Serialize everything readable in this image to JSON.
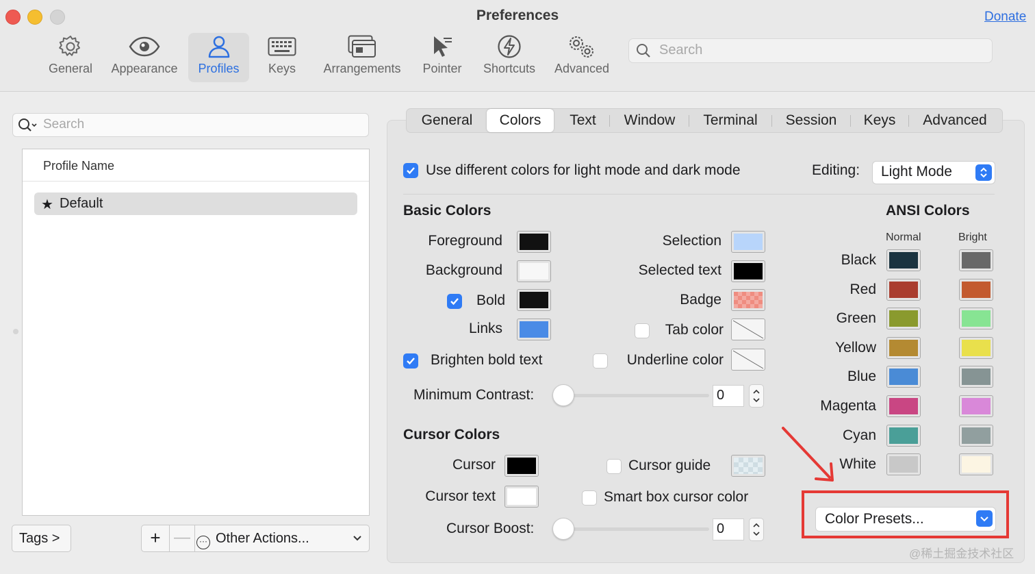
{
  "window": {
    "title": "Preferences",
    "donate": "Donate"
  },
  "toolbar": {
    "items": [
      {
        "label": "General",
        "icon": "gear-icon"
      },
      {
        "label": "Appearance",
        "icon": "eye-icon"
      },
      {
        "label": "Profiles",
        "icon": "person-icon",
        "selected": true
      },
      {
        "label": "Keys",
        "icon": "keyboard-icon"
      },
      {
        "label": "Arrangements",
        "icon": "windows-icon"
      },
      {
        "label": "Pointer",
        "icon": "pointer-icon"
      },
      {
        "label": "Shortcuts",
        "icon": "lightning-icon"
      },
      {
        "label": "Advanced",
        "icon": "gears-icon"
      }
    ],
    "search_placeholder": "Search"
  },
  "left": {
    "search_placeholder": "Search",
    "column_header": "Profile Name",
    "profiles": [
      {
        "name": "Default",
        "star": "★"
      }
    ],
    "tags_button": "Tags >",
    "plus": "+",
    "minus": "—",
    "other_actions": "Other Actions..."
  },
  "tabs": [
    "General",
    "Colors",
    "Text",
    "Window",
    "Terminal",
    "Session",
    "Keys",
    "Advanced"
  ],
  "selected_tab": "Colors",
  "colors": {
    "use_different": "Use different colors for light mode and dark mode",
    "editing_label": "Editing:",
    "editing_value": "Light Mode",
    "basic_header": "Basic Colors",
    "foreground": "Foreground",
    "background": "Background",
    "bold": "Bold",
    "links": "Links",
    "selection": "Selection",
    "selected_text": "Selected text",
    "badge": "Badge",
    "tab_color": "Tab color",
    "underline_color": "Underline color",
    "brighten_bold": "Brighten bold text",
    "min_contrast": "Minimum Contrast:",
    "min_contrast_value": "0",
    "cursor_header": "Cursor Colors",
    "cursor": "Cursor",
    "cursor_text": "Cursor text",
    "cursor_guide": "Cursor guide",
    "smart_box": "Smart box cursor color",
    "cursor_boost": "Cursor Boost:",
    "cursor_boost_value": "0",
    "swatches": {
      "foreground": "#111111",
      "background": "#f7f7f7",
      "bold": "#111111",
      "links": "#4a8be6",
      "selection": "#b8d5fb",
      "selected_text": "#000000",
      "badge": "#ef8c80",
      "cursor": "#000000",
      "cursor_text": "#ffffff"
    },
    "ansi_header": "ANSI Colors",
    "ansi_normal": "Normal",
    "ansi_bright": "Bright",
    "ansi": [
      {
        "name": "Black",
        "normal": "#1a3340",
        "bright": "#686868"
      },
      {
        "name": "Red",
        "normal": "#aa3d2f",
        "bright": "#c35a2f"
      },
      {
        "name": "Green",
        "normal": "#8a9a2e",
        "bright": "#87e493"
      },
      {
        "name": "Yellow",
        "normal": "#b48a32",
        "bright": "#e9e04c"
      },
      {
        "name": "Blue",
        "normal": "#4a8bd6",
        "bright": "#869494"
      },
      {
        "name": "Magenta",
        "normal": "#c94683",
        "bright": "#d988d9"
      },
      {
        "name": "Cyan",
        "normal": "#4a9f98",
        "bright": "#919f9f"
      },
      {
        "name": "White",
        "normal": "#c8c8c8",
        "bright": "#fcf5e3"
      }
    ],
    "color_presets": "Color Presets...",
    "annotation_color": "#e53935"
  },
  "watermark": "@稀土掘金技术社区"
}
